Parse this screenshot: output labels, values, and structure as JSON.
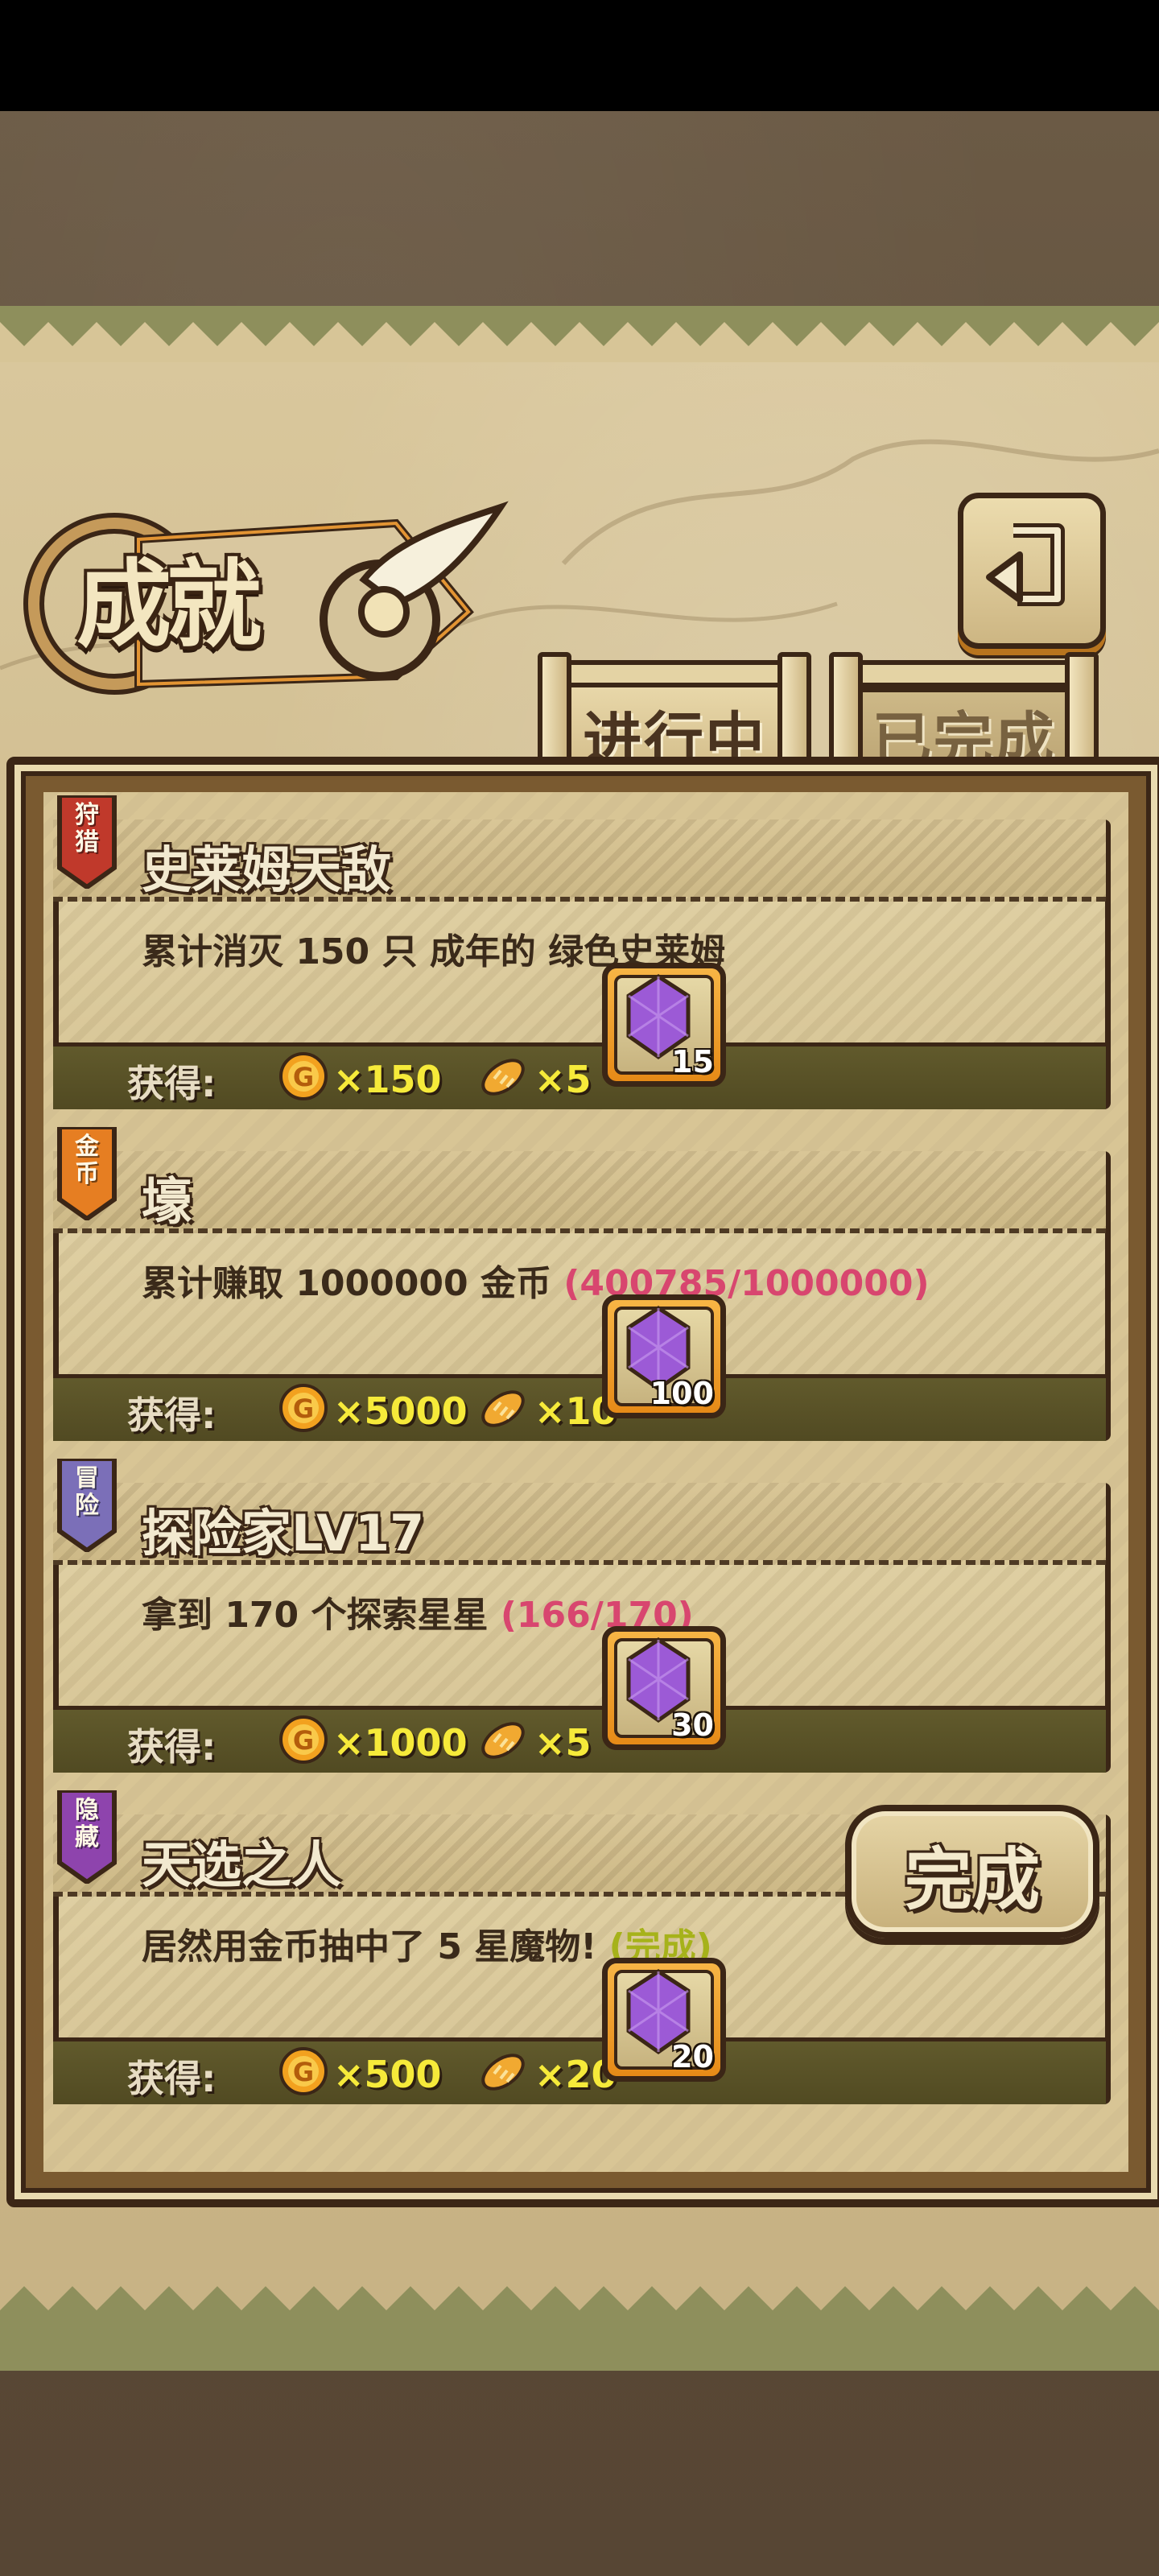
{
  "title": "成就",
  "tabs": {
    "active": "进行中",
    "inactive": "已完成"
  },
  "reward_prefix": "获得:",
  "achievements": [
    {
      "category": "狩猎",
      "ribbon_color": "#c0392b",
      "title": "史莱姆天敌",
      "description": "累计消灭 150 只 成年的 绿色史莱姆",
      "progress": "",
      "coins": "×150",
      "bread": "×5",
      "gems": "15"
    },
    {
      "category": "金币",
      "ribbon_color": "#e67e22",
      "title": "壕",
      "description": "累计赚取 1000000 金币",
      "progress": "(400785/1000000)",
      "coins": "×5000",
      "bread": "×10",
      "gems": "100"
    },
    {
      "category": "冒险",
      "ribbon_color": "#7b6fb8",
      "title": "探险家LV17",
      "description": "拿到 170 个探索星星",
      "progress": "(166/170)",
      "coins": "×1000",
      "bread": "×5",
      "gems": "30"
    },
    {
      "category": "隐藏",
      "ribbon_color": "#8e44ad",
      "title": "天选之人",
      "description": "居然用金币抽中了 5 星魔物!",
      "progress": "(完成)",
      "coins": "×500",
      "bread": "×20",
      "gems": "20",
      "complete_button": "完成"
    }
  ]
}
